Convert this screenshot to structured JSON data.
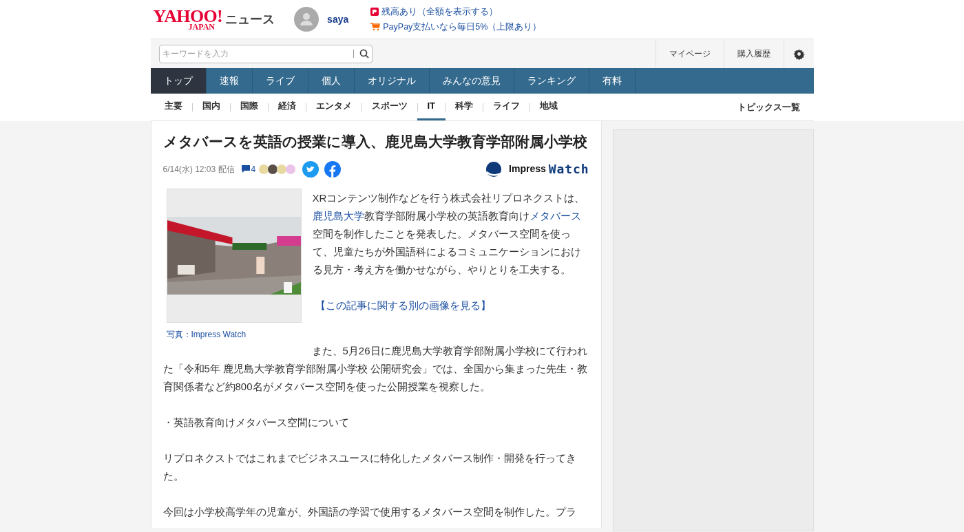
{
  "header": {
    "logo_main": "YAHOO!",
    "logo_sub": "JAPAN",
    "service": "ニュース",
    "user": "saya",
    "promos": [
      {
        "kind": "balance",
        "text": "残高あり（全額を表示する）"
      },
      {
        "kind": "cart",
        "text": "PayPay支払いなら毎日5%（上限あり）"
      }
    ]
  },
  "search": {
    "placeholder": "キーワードを入力"
  },
  "user_links": [
    "マイページ",
    "購入履歴"
  ],
  "nav": [
    {
      "label": "トップ",
      "selected": true
    },
    {
      "label": "速報",
      "selected": false
    },
    {
      "label": "ライブ",
      "selected": false
    },
    {
      "label": "個人",
      "selected": false
    },
    {
      "label": "オリジナル",
      "selected": false
    },
    {
      "label": "みんなの意見",
      "selected": false
    },
    {
      "label": "ランキング",
      "selected": false
    },
    {
      "label": "有料",
      "selected": false
    }
  ],
  "categories": [
    {
      "label": "主要",
      "selected": false
    },
    {
      "label": "国内",
      "selected": false
    },
    {
      "label": "国際",
      "selected": false
    },
    {
      "label": "経済",
      "selected": false
    },
    {
      "label": "エンタメ",
      "selected": false
    },
    {
      "label": "スポーツ",
      "selected": false
    },
    {
      "label": "IT",
      "selected": true
    },
    {
      "label": "科学",
      "selected": false
    },
    {
      "label": "ライフ",
      "selected": false
    },
    {
      "label": "地域",
      "selected": false
    }
  ],
  "topics_link": "トピックス一覧",
  "article": {
    "title": "メタバースを英語の授業に導入、鹿児島大学教育学部附属小学校",
    "date": "6/14(水) 12:03 配信",
    "comments": "4",
    "source_logo": {
      "first": "Impress",
      "second": "Watch"
    },
    "photo": {
      "kind": "picture",
      "caption": "写真：Impress Watch"
    },
    "paragraphs": [
      [
        {
          "text": "XRコンテンツ制作などを行う株式会社リプロネクストは、",
          "link": false
        },
        {
          "text": "鹿児島大学",
          "link": true
        },
        {
          "text": "教育学部附属小学校の英語教育向け",
          "link": false
        },
        {
          "text": "メタバース",
          "link": true
        },
        {
          "text": "空間を制作したことを発表した。メタバース空間を使って、児童たちが外国語科によるコミュニケーションにおける見方・考え方を働かせながら、やりとりを工夫する。",
          "link": false
        }
      ],
      [
        {
          "text": "【この記事に関する別の画像を見る】",
          "link": true
        }
      ],
      [
        {
          "text": "また、5月26日に鹿児島大学教育学部附属小学校にて行われた「令和5年 鹿児島大学教育学部附属小学校 公開研究会」では、全国から集まった先生・教育関係者など約800名がメタバース空間を使った公開授業を視察した。",
          "link": false
        }
      ],
      [
        {
          "text": "・英語教育向けメタバース空間について",
          "link": false
        }
      ],
      [
        {
          "text": "リプロネクストではこれまでビジネスユースに特化したメタバース制作・開発を行ってきた。",
          "link": false
        }
      ],
      [
        {
          "text": "今回は小学校高学年の児童が、外国語の学習で使用するメタバース空間を制作した。プラ",
          "link": false
        }
      ]
    ]
  }
}
